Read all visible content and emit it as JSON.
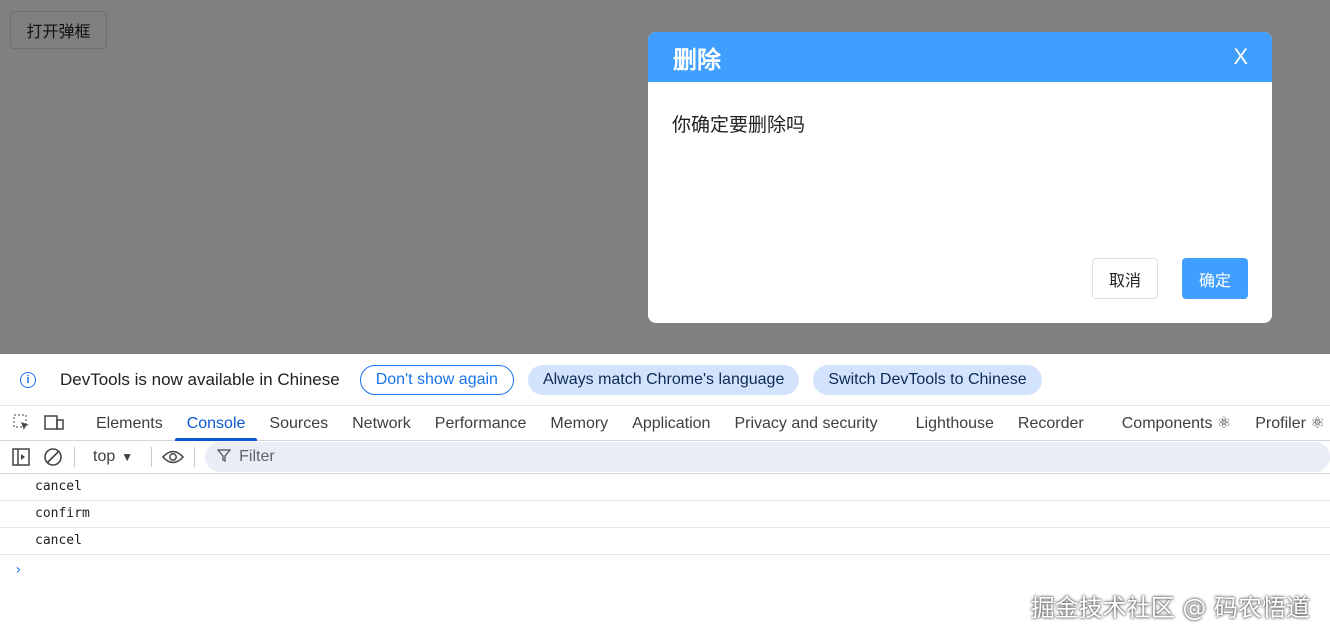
{
  "page": {
    "open_button": "打开弹框"
  },
  "dialog": {
    "title": "删除",
    "close": "X",
    "message": "你确定要删除吗",
    "cancel": "取消",
    "confirm": "确定",
    "header_color": "#409eff"
  },
  "devtools": {
    "infobar": {
      "text": "DevTools is now available in Chinese",
      "dont_show": "Don't show again",
      "match_lang": "Always match Chrome's language",
      "switch": "Switch DevTools to Chinese"
    },
    "tabs": [
      {
        "label": "Elements"
      },
      {
        "label": "Console",
        "active": true
      },
      {
        "label": "Sources"
      },
      {
        "label": "Network"
      },
      {
        "label": "Performance"
      },
      {
        "label": "Memory"
      },
      {
        "label": "Application"
      },
      {
        "label": "Privacy and security"
      },
      {
        "label": "Lighthouse"
      },
      {
        "label": "Recorder"
      },
      {
        "label": "Components ⚛"
      },
      {
        "label": "Profiler ⚛"
      }
    ],
    "toolbar": {
      "context": "top",
      "filter_placeholder": "Filter"
    },
    "console_lines": [
      "cancel",
      "confirm",
      "cancel"
    ],
    "prompt": "›"
  },
  "watermark": "掘金技术社区 @ 码农悟道"
}
